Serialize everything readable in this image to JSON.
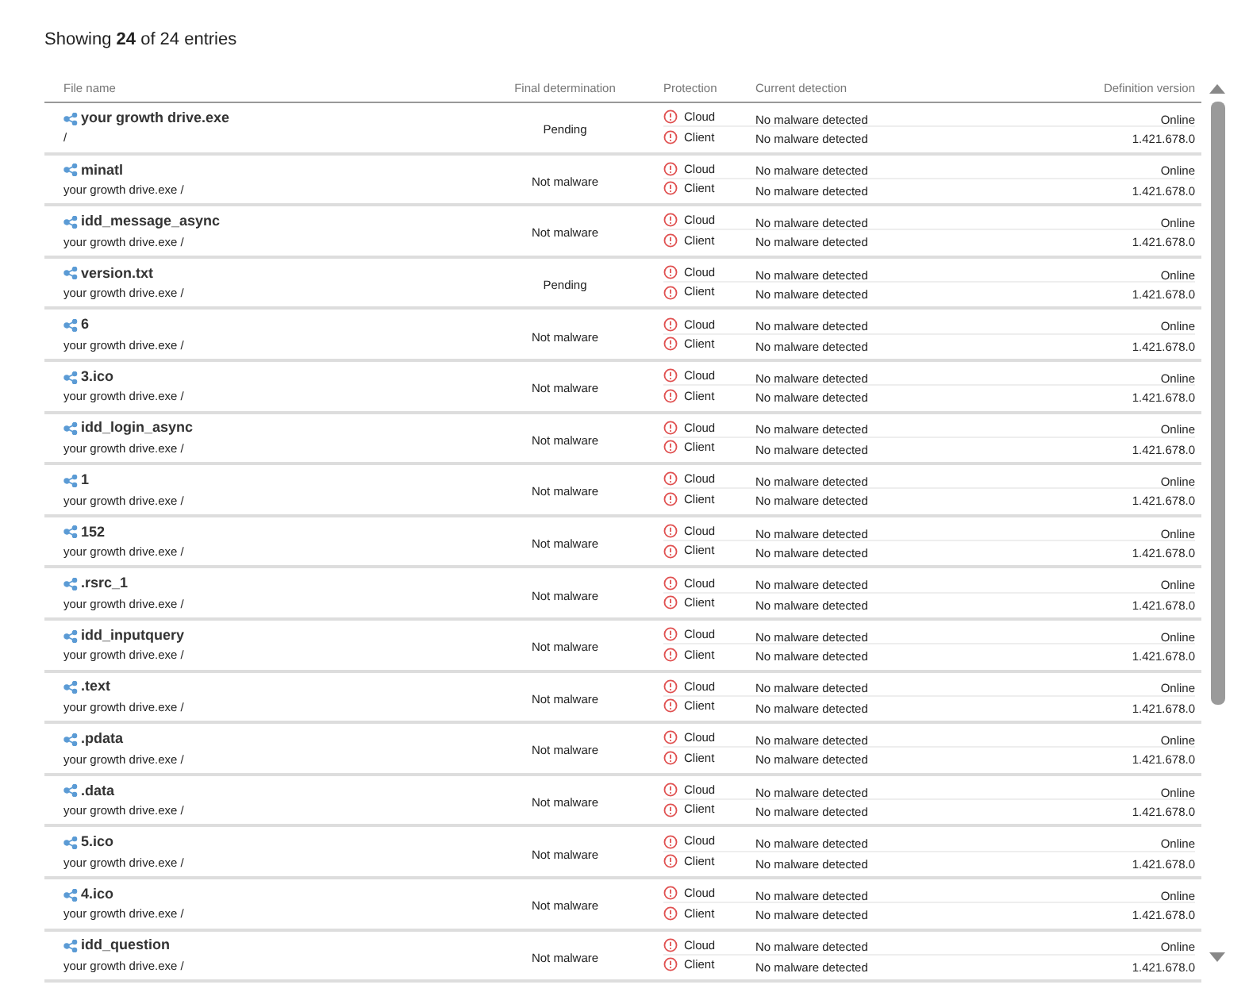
{
  "summary": "Showing **24** of 24 entries",
  "columns": [
    "File name",
    "Final determination",
    "Protection",
    "Current detection",
    "Definition version"
  ],
  "rows": [
    {
      "name": "your growth drive.exe",
      "path": "/",
      "determination": "Pending",
      "checks": [
        {
          "label": "Cloud",
          "detection": "No malware detected",
          "version": "Online"
        },
        {
          "label": "Client",
          "detection": "No malware detected",
          "version": "1.421.678.0"
        }
      ]
    },
    {
      "name": "minatl",
      "path": "your growth drive.exe /",
      "determination": "Not malware",
      "checks": [
        {
          "label": "Cloud",
          "detection": "No malware detected",
          "version": "Online"
        },
        {
          "label": "Client",
          "detection": "No malware detected",
          "version": "1.421.678.0"
        }
      ]
    },
    {
      "name": "idd_message_async",
      "path": "your growth drive.exe /",
      "determination": "Not malware",
      "checks": [
        {
          "label": "Cloud",
          "detection": "No malware detected",
          "version": "Online"
        },
        {
          "label": "Client",
          "detection": "No malware detected",
          "version": "1.421.678.0"
        }
      ]
    },
    {
      "name": "version.txt",
      "path": "your growth drive.exe /",
      "determination": "Pending",
      "checks": [
        {
          "label": "Cloud",
          "detection": "No malware detected",
          "version": "Online"
        },
        {
          "label": "Client",
          "detection": "No malware detected",
          "version": "1.421.678.0"
        }
      ]
    },
    {
      "name": "6",
      "path": "your growth drive.exe /",
      "determination": "Not malware",
      "checks": [
        {
          "label": "Cloud",
          "detection": "No malware detected",
          "version": "Online"
        },
        {
          "label": "Client",
          "detection": "No malware detected",
          "version": "1.421.678.0"
        }
      ]
    },
    {
      "name": "3.ico",
      "path": "your growth drive.exe /",
      "determination": "Not malware",
      "checks": [
        {
          "label": "Cloud",
          "detection": "No malware detected",
          "version": "Online"
        },
        {
          "label": "Client",
          "detection": "No malware detected",
          "version": "1.421.678.0"
        }
      ]
    },
    {
      "name": "idd_login_async",
      "path": "your growth drive.exe /",
      "determination": "Not malware",
      "checks": [
        {
          "label": "Cloud",
          "detection": "No malware detected",
          "version": "Online"
        },
        {
          "label": "Client",
          "detection": "No malware detected",
          "version": "1.421.678.0"
        }
      ]
    },
    {
      "name": "1",
      "path": "your growth drive.exe /",
      "determination": "Not malware",
      "checks": [
        {
          "label": "Cloud",
          "detection": "No malware detected",
          "version": "Online"
        },
        {
          "label": "Client",
          "detection": "No malware detected",
          "version": "1.421.678.0"
        }
      ]
    },
    {
      "name": "152",
      "path": "your growth drive.exe /",
      "determination": "Not malware",
      "checks": [
        {
          "label": "Cloud",
          "detection": "No malware detected",
          "version": "Online"
        },
        {
          "label": "Client",
          "detection": "No malware detected",
          "version": "1.421.678.0"
        }
      ]
    },
    {
      "name": ".rsrc_1",
      "path": "your growth drive.exe /",
      "determination": "Not malware",
      "checks": [
        {
          "label": "Cloud",
          "detection": "No malware detected",
          "version": "Online"
        },
        {
          "label": "Client",
          "detection": "No malware detected",
          "version": "1.421.678.0"
        }
      ]
    },
    {
      "name": "idd_inputquery",
      "path": "your growth drive.exe /",
      "determination": "Not malware",
      "checks": [
        {
          "label": "Cloud",
          "detection": "No malware detected",
          "version": "Online"
        },
        {
          "label": "Client",
          "detection": "No malware detected",
          "version": "1.421.678.0"
        }
      ]
    },
    {
      "name": ".text",
      "path": "your growth drive.exe /",
      "determination": "Not malware",
      "checks": [
        {
          "label": "Cloud",
          "detection": "No malware detected",
          "version": "Online"
        },
        {
          "label": "Client",
          "detection": "No malware detected",
          "version": "1.421.678.0"
        }
      ]
    },
    {
      "name": ".pdata",
      "path": "your growth drive.exe /",
      "determination": "Not malware",
      "checks": [
        {
          "label": "Cloud",
          "detection": "No malware detected",
          "version": "Online"
        },
        {
          "label": "Client",
          "detection": "No malware detected",
          "version": "1.421.678.0"
        }
      ]
    },
    {
      "name": ".data",
      "path": "your growth drive.exe /",
      "determination": "Not malware",
      "checks": [
        {
          "label": "Cloud",
          "detection": "No malware detected",
          "version": "Online"
        },
        {
          "label": "Client",
          "detection": "No malware detected",
          "version": "1.421.678.0"
        }
      ]
    },
    {
      "name": "5.ico",
      "path": "your growth drive.exe /",
      "determination": "Not malware",
      "checks": [
        {
          "label": "Cloud",
          "detection": "No malware detected",
          "version": "Online"
        },
        {
          "label": "Client",
          "detection": "No malware detected",
          "version": "1.421.678.0"
        }
      ]
    },
    {
      "name": "4.ico",
      "path": "your growth drive.exe /",
      "determination": "Not malware",
      "checks": [
        {
          "label": "Cloud",
          "detection": "No malware detected",
          "version": "Online"
        },
        {
          "label": "Client",
          "detection": "No malware detected",
          "version": "1.421.678.0"
        }
      ]
    },
    {
      "name": "idd_question",
      "path": "your growth drive.exe /",
      "determination": "Not malware",
      "checks": [
        {
          "label": "Cloud",
          "detection": "No malware detected",
          "version": "Online"
        },
        {
          "label": "Client",
          "detection": "No malware detected",
          "version": "1.421.678.0"
        }
      ]
    }
  ]
}
